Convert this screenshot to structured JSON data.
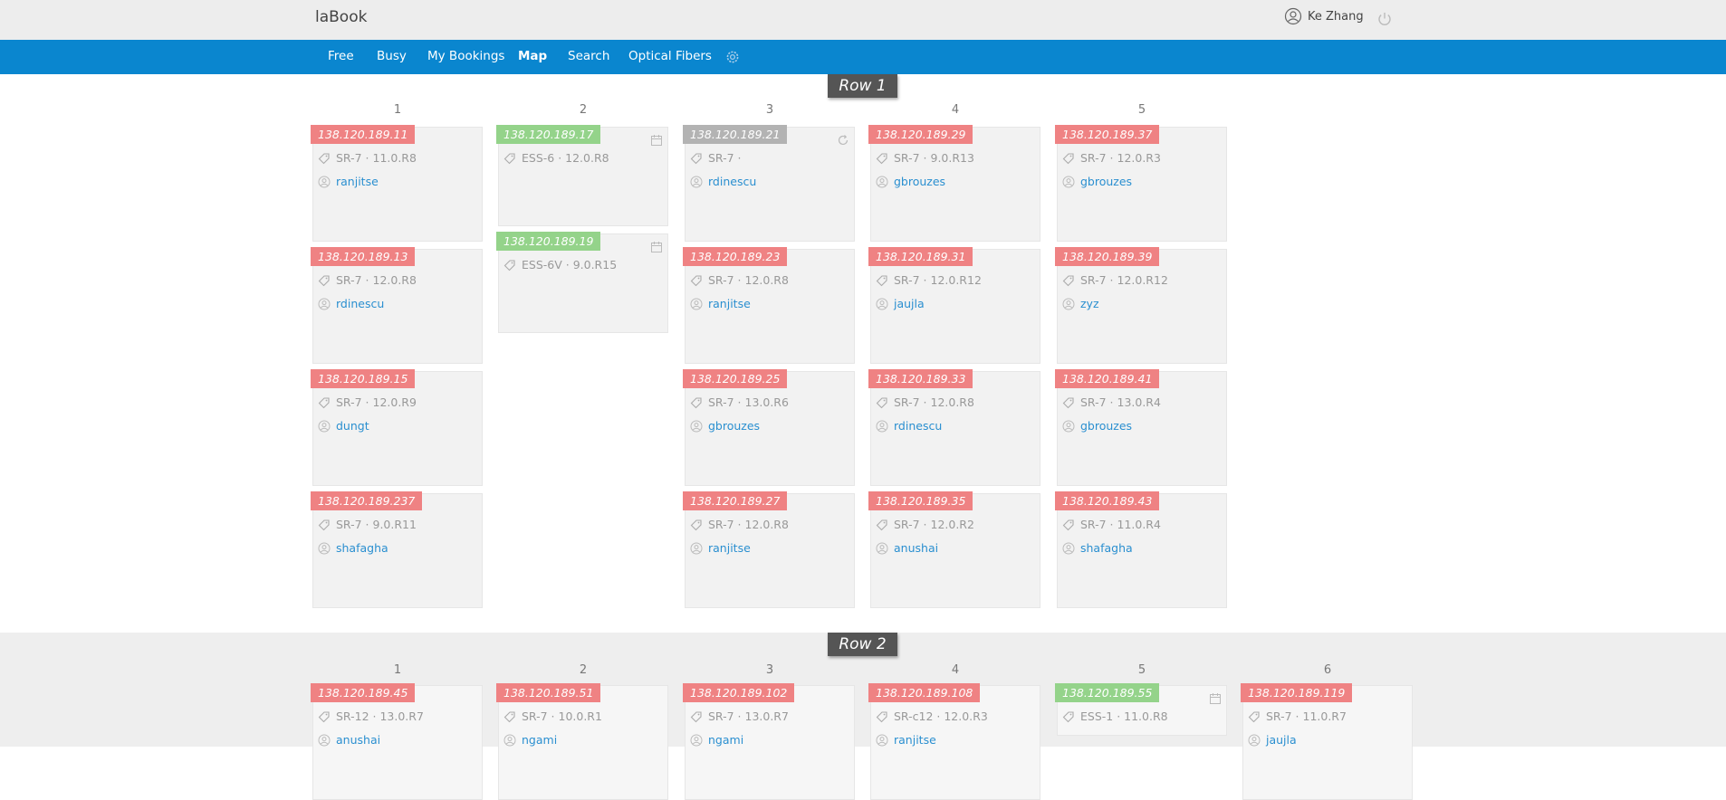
{
  "app": {
    "title": "laBook"
  },
  "user": {
    "name": "Ke Zhang"
  },
  "nav": [
    "Free",
    "Busy",
    "My Bookings",
    "Map",
    "Search",
    "Optical Fibers"
  ],
  "nav_active": "Map",
  "rows": [
    {
      "label": "Row 1",
      "columns": [
        {
          "num": "1",
          "cards": [
            {
              "ip": "138.120.189.11",
              "status": "busy",
              "spec": "SR-7 · 11.0.R8",
              "owner": "ranjitse"
            },
            {
              "ip": "138.120.189.13",
              "status": "busy",
              "spec": "SR-7 · 12.0.R8",
              "owner": "rdinescu"
            },
            {
              "ip": "138.120.189.15",
              "status": "busy",
              "spec": "SR-7 · 12.0.R9",
              "owner": "dungt"
            },
            {
              "ip": "138.120.189.237",
              "status": "busy",
              "spec": "SR-7 · 9.0.R11",
              "owner": "shafagha"
            }
          ]
        },
        {
          "num": "2",
          "cards": [
            {
              "ip": "138.120.189.17",
              "status": "free",
              "spec": "ESS-6 · 12.0.R8",
              "owner": "",
              "icon": "calendar-icon"
            },
            {
              "ip": "138.120.189.19",
              "status": "free",
              "spec": "ESS-6V · 9.0.R15",
              "owner": "",
              "icon": "calendar-icon"
            }
          ]
        },
        {
          "num": "3",
          "cards": [
            {
              "ip": "138.120.189.21",
              "status": "unknown",
              "spec": "SR-7 ·",
              "owner": "rdinescu",
              "icon": "refresh-icon"
            },
            {
              "ip": "138.120.189.23",
              "status": "busy",
              "spec": "SR-7 · 12.0.R8",
              "owner": "ranjitse"
            },
            {
              "ip": "138.120.189.25",
              "status": "busy",
              "spec": "SR-7 · 13.0.R6",
              "owner": "gbrouzes"
            },
            {
              "ip": "138.120.189.27",
              "status": "busy",
              "spec": "SR-7 · 12.0.R8",
              "owner": "ranjitse"
            }
          ]
        },
        {
          "num": "4",
          "cards": [
            {
              "ip": "138.120.189.29",
              "status": "busy",
              "spec": "SR-7 · 9.0.R13",
              "owner": "gbrouzes"
            },
            {
              "ip": "138.120.189.31",
              "status": "busy",
              "spec": "SR-7 · 12.0.R12",
              "owner": "jaujla"
            },
            {
              "ip": "138.120.189.33",
              "status": "busy",
              "spec": "SR-7 · 12.0.R8",
              "owner": "rdinescu"
            },
            {
              "ip": "138.120.189.35",
              "status": "busy",
              "spec": "SR-7 · 12.0.R2",
              "owner": "anushai"
            }
          ]
        },
        {
          "num": "5",
          "cards": [
            {
              "ip": "138.120.189.37",
              "status": "busy",
              "spec": "SR-7 · 12.0.R3",
              "owner": "gbrouzes"
            },
            {
              "ip": "138.120.189.39",
              "status": "busy",
              "spec": "SR-7 · 12.0.R12",
              "owner": "zyz"
            },
            {
              "ip": "138.120.189.41",
              "status": "busy",
              "spec": "SR-7 · 13.0.R4",
              "owner": "gbrouzes"
            },
            {
              "ip": "138.120.189.43",
              "status": "busy",
              "spec": "SR-7 · 11.0.R4",
              "owner": "shafagha"
            }
          ]
        }
      ]
    },
    {
      "label": "Row 2",
      "columns": [
        {
          "num": "1",
          "cards": [
            {
              "ip": "138.120.189.45",
              "status": "busy",
              "spec": "SR-12 · 13.0.R7",
              "owner": "anushai"
            }
          ]
        },
        {
          "num": "2",
          "cards": [
            {
              "ip": "138.120.189.51",
              "status": "busy",
              "spec": "SR-7 · 10.0.R1",
              "owner": "ngami"
            }
          ]
        },
        {
          "num": "3",
          "cards": [
            {
              "ip": "138.120.189.102",
              "status": "busy",
              "spec": "SR-7 · 13.0.R7",
              "owner": "ngami"
            }
          ]
        },
        {
          "num": "4",
          "cards": [
            {
              "ip": "138.120.189.108",
              "status": "busy",
              "spec": "SR-c12 · 12.0.R3",
              "owner": "ranjitse"
            }
          ]
        },
        {
          "num": "5",
          "cards": [
            {
              "ip": "138.120.189.55",
              "status": "free",
              "spec": "ESS-1 · 11.0.R8",
              "owner": "",
              "icon": "calendar-icon"
            }
          ]
        },
        {
          "num": "6",
          "cards": [
            {
              "ip": "138.120.189.119",
              "status": "busy",
              "spec": "SR-7 · 11.0.R7",
              "owner": "jaujla"
            }
          ]
        }
      ]
    }
  ],
  "colors": {
    "busy": "#ef8283",
    "free": "#94d38a",
    "unknown": "#b3b3b3",
    "nav": "#0a86cf",
    "link": "#2a8fd0"
  }
}
